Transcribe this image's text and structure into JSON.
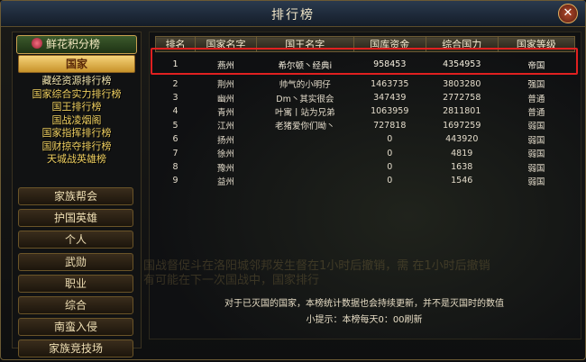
{
  "window": {
    "title": "排行榜",
    "close_label": "✕"
  },
  "sidebar": {
    "header": "鲜花积分榜",
    "active_category": "国家",
    "subitems": [
      "藏经资源排行榜",
      "国家综合实力排行榜",
      "国王排行榜",
      "国战凌烟阁",
      "国家指挥排行榜",
      "国财掠夺排行榜",
      "天城战英雄榜"
    ],
    "categories": [
      "家族帮会",
      "护国英雄",
      "个人",
      "武勋",
      "职业",
      "综合",
      "南蛮入侵",
      "家族竞技场"
    ]
  },
  "table": {
    "headers": [
      "排名",
      "国家名字",
      "国王名字",
      "国库资金",
      "综合国力",
      "国家等级"
    ],
    "rows": [
      [
        "1",
        "燕州",
        "希尔顿丶经典i",
        "958453",
        "4354953",
        "帝国"
      ],
      [
        "2",
        "荆州",
        "帅气的小明仔",
        "1463735",
        "3803280",
        "强国"
      ],
      [
        "3",
        "幽州",
        "Dm丶其实很会",
        "347439",
        "2772758",
        "普通"
      ],
      [
        "4",
        "青州",
        "叶寓丨站为兄弟",
        "1063959",
        "2811801",
        "普通"
      ],
      [
        "5",
        "江州",
        "老猪爱你们呦丶",
        "727818",
        "1697259",
        "弱国"
      ],
      [
        "6",
        "扬州",
        "",
        "0",
        "443920",
        "弱国"
      ],
      [
        "7",
        "徐州",
        "",
        "0",
        "4819",
        "弱国"
      ],
      [
        "8",
        "豫州",
        "",
        "0",
        "1638",
        "弱国"
      ],
      [
        "9",
        "益州",
        "",
        "0",
        "1546",
        "弱国"
      ]
    ]
  },
  "notes": {
    "line1": "对于已灭国的国家，本榜统计数据也会持续更新，并不是灭国时的数值",
    "line2": "小提示：本榜每天0：00刷新"
  },
  "watermark": "国战督促斗在洛阳城邻邦发生督在1小时后撤销，需  在1小时后撤销有可能在下一次国战中，国家排行",
  "colors": {
    "highlight_border": "#e02020",
    "active_tab": "#e0b040",
    "title_bar": "#1e2a3a"
  }
}
